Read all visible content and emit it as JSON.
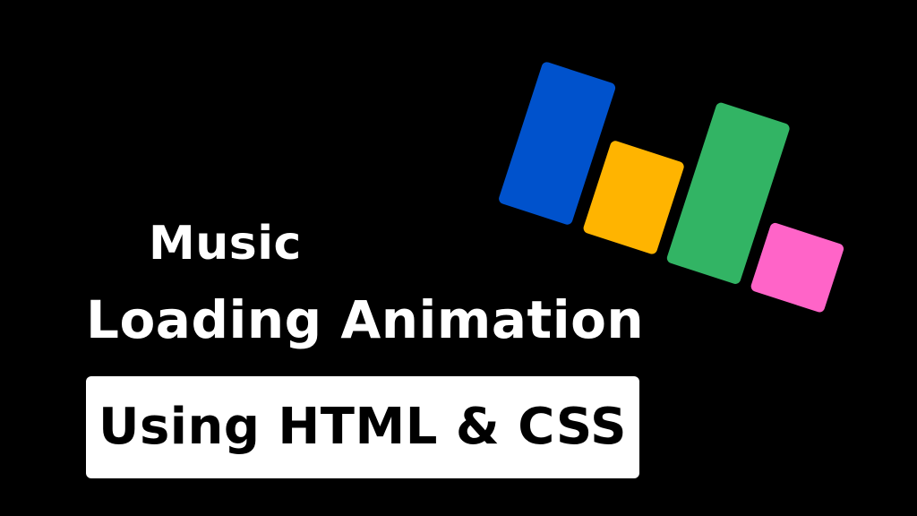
{
  "title": {
    "line1": "Music",
    "line2": "Loading Animation"
  },
  "badge": {
    "label": "Using HTML & CSS"
  },
  "loader_bars": [
    {
      "name": "blue",
      "color": "#0052cc"
    },
    {
      "name": "yellow",
      "color": "#ffb400"
    },
    {
      "name": "green",
      "color": "#32b464"
    },
    {
      "name": "pink",
      "color": "#ff64c8"
    }
  ],
  "colors": {
    "background": "#000000",
    "text": "#ffffff",
    "badge_background": "#ffffff",
    "badge_text": "#000000"
  }
}
